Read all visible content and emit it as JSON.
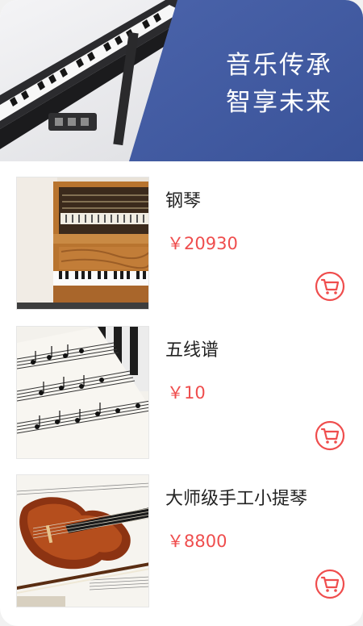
{
  "banner": {
    "line1": "音乐传承",
    "line2": "智享未来",
    "accent_color": "#3f5aa0"
  },
  "products": [
    {
      "name": "钢琴",
      "price": "￥20930",
      "image": "upright-piano-photo"
    },
    {
      "name": "五线谱",
      "price": "￥10",
      "image": "sheet-music-photo"
    },
    {
      "name": "大师级手工小提琴",
      "price": "￥8800",
      "image": "violin-photo"
    }
  ],
  "colors": {
    "price": "#ef4d4d",
    "cart_icon": "#ef4d4d"
  },
  "icons": {
    "cart": "shopping-cart-icon"
  }
}
